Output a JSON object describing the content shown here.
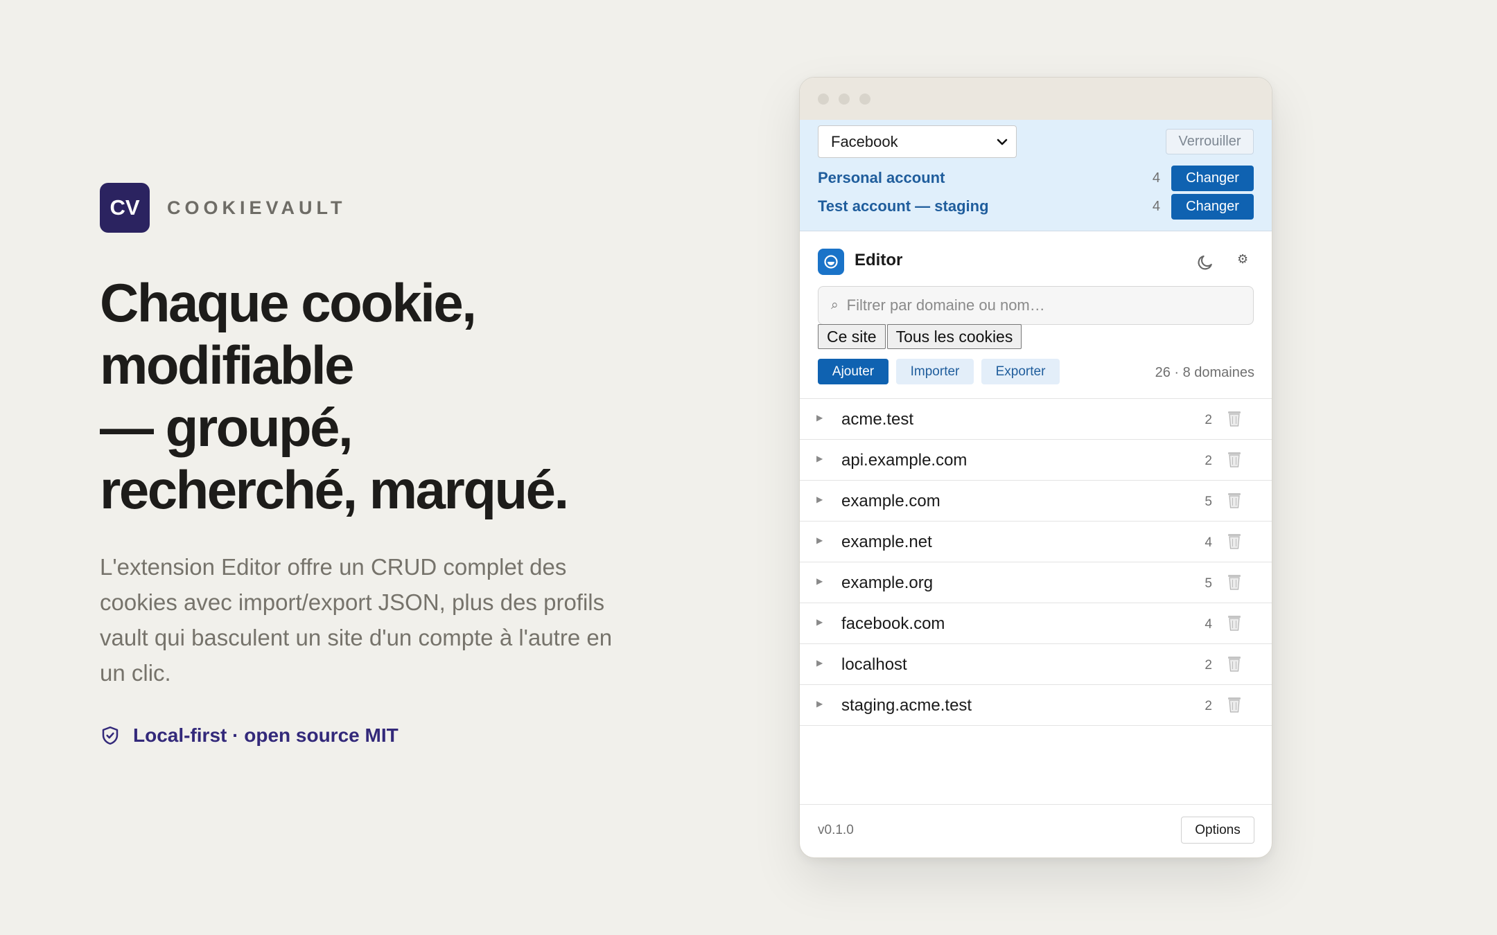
{
  "brand": {
    "logo": "CV",
    "name": "COOKIEVAULT"
  },
  "hero": {
    "headline_lines": [
      "Chaque cookie,",
      "modifiable",
      "— groupé,",
      "recherché, marqué."
    ],
    "description": "L'extension Editor offre un CRUD complet des cookies avec import/export JSON, plus des profils vault qui basculent un site d'un compte à l'autre en un clic.",
    "tagline": "Local-first · open source MIT",
    "tagline_icon": "shield-check-icon"
  },
  "vault": {
    "selected_site": "Facebook",
    "lock_label": "Verrouiller",
    "profiles": [
      {
        "name": "Personal account",
        "count": "4",
        "action": "Changer"
      },
      {
        "name": "Test account — staging",
        "count": "4",
        "action": "Changer"
      }
    ]
  },
  "editor": {
    "title": "Editor",
    "theme_icon": "moon-icon",
    "settings_icon": "gear-icon",
    "search": {
      "placeholder": "Filtrer par domaine ou nom…",
      "value": ""
    },
    "scope_tabs": [
      "Ce site",
      "Tous les cookies"
    ],
    "actions": {
      "add": "Ajouter",
      "import": "Importer",
      "export": "Exporter"
    },
    "summary": "26 · 8 domaines",
    "domains": [
      {
        "name": "acme.test",
        "count": "2"
      },
      {
        "name": "api.example.com",
        "count": "2"
      },
      {
        "name": "example.com",
        "count": "5"
      },
      {
        "name": "example.net",
        "count": "4"
      },
      {
        "name": "example.org",
        "count": "5"
      },
      {
        "name": "facebook.com",
        "count": "4"
      },
      {
        "name": "localhost",
        "count": "2"
      },
      {
        "name": "staging.acme.test",
        "count": "2"
      }
    ],
    "version": "v0.1.0",
    "options_label": "Options"
  },
  "colors": {
    "background": "#f1f0eb",
    "brand_logo": "#2b2360",
    "accent_blue": "#0f62b1",
    "vault_bg": "#e0effb",
    "tagline": "#33297a"
  }
}
